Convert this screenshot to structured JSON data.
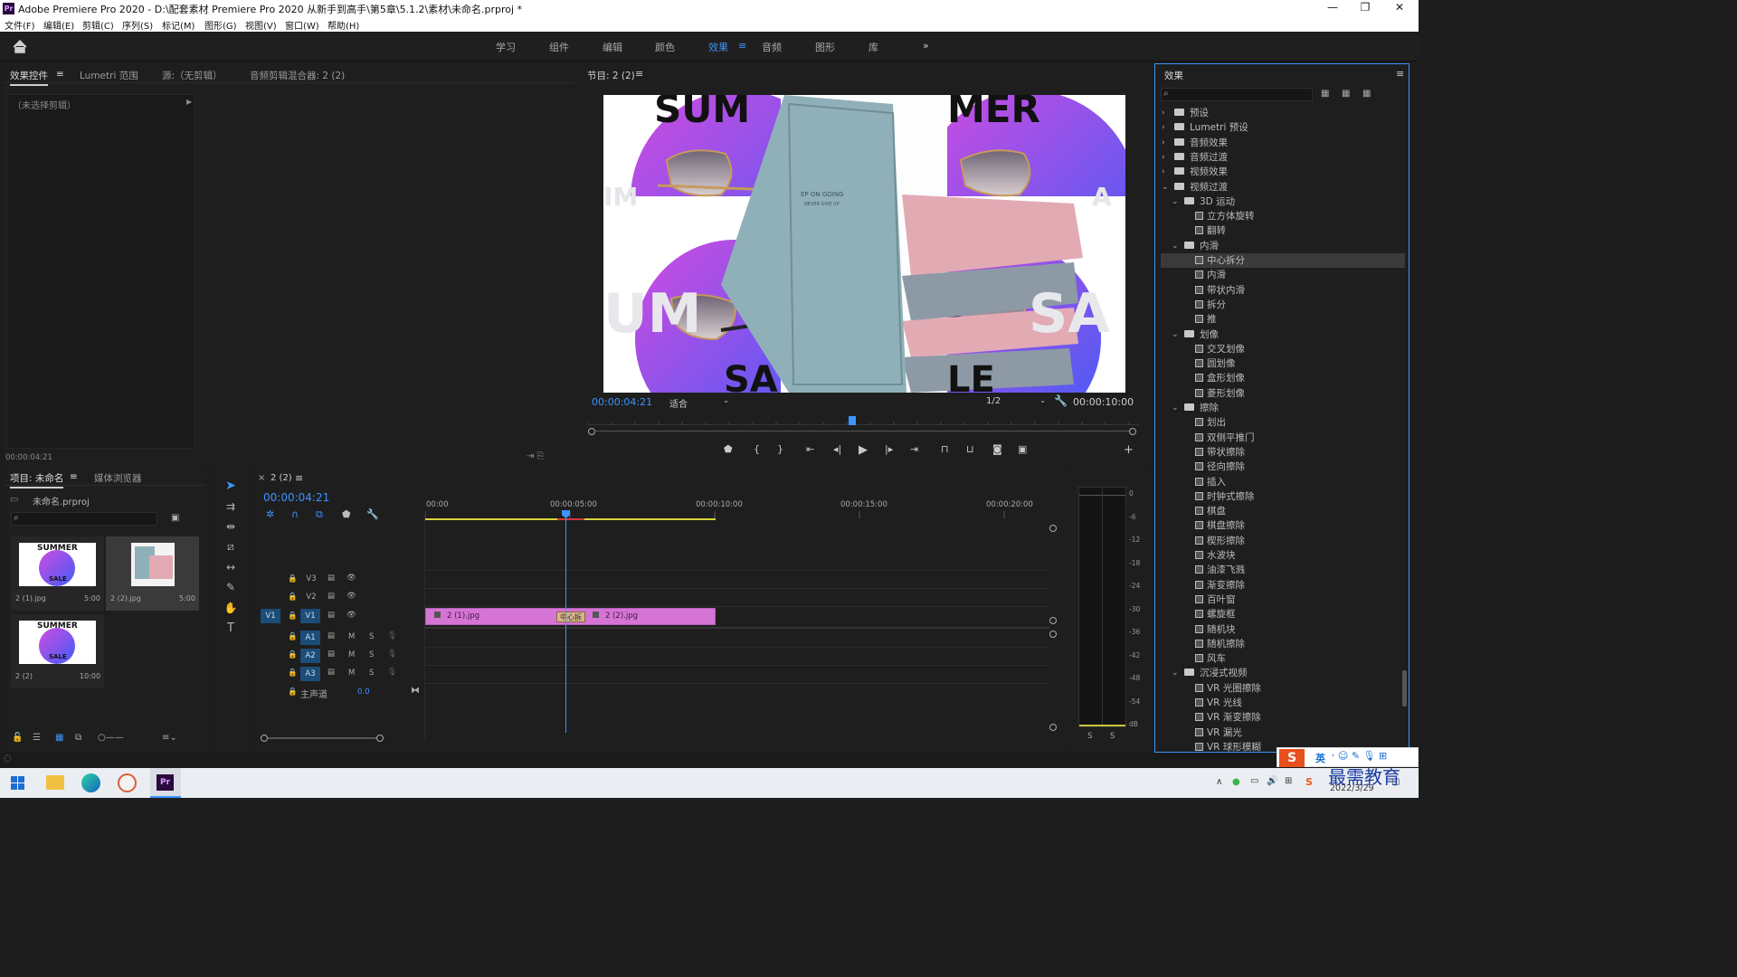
{
  "titlebar": {
    "icon_label": "Pr",
    "title": "Adobe Premiere Pro 2020 - D:\\配套素材 Premiere Pro 2020 从新手到高手\\第5章\\5.1.2\\素材\\未命名.prproj *",
    "minimize": "—",
    "maximize": "❐",
    "close": "✕"
  },
  "menu": [
    "文件(F)",
    "编辑(E)",
    "剪辑(C)",
    "序列(S)",
    "标记(M)",
    "图形(G)",
    "视图(V)",
    "窗口(W)",
    "帮助(H)"
  ],
  "workspaces": [
    "学习",
    "组件",
    "编辑",
    "颜色",
    "效果",
    "音频",
    "图形",
    "库"
  ],
  "workspace_active": "效果",
  "workspace_more": "»",
  "source_panel": {
    "tabs": [
      "效果控件",
      "Lumetri 范围",
      "源:（无剪辑）",
      "音频剪辑混合器: 2 (2)"
    ],
    "no_clip": "（未选择剪辑）",
    "timecode": "00:00:04:21"
  },
  "program": {
    "title": "节目: 2 (2)",
    "timecode": "00:00:04:21",
    "fit": "适合",
    "quality": "1/2",
    "duration": "00:00:10:00",
    "frame_text": {
      "tl": "SUM",
      "tr": "MER",
      "bl": "SA",
      "br": "LE",
      "wm_left": "UM",
      "wm_right": "SA",
      "wm_top": "IM",
      "wm_top_r": "A",
      "notebook_line1": "EP ON GOING",
      "notebook_line2": "NEVER GIVE UP"
    },
    "controls": [
      "marker",
      "in",
      "out",
      "goto-in",
      "step-back",
      "play",
      "step-forward",
      "goto-out",
      "lift",
      "extract",
      "export-frame",
      "compare",
      "add"
    ]
  },
  "project": {
    "tabs": [
      "项目: 未命名",
      "媒体浏览器"
    ],
    "file": "未命名.prproj",
    "items": [
      {
        "name": "2 (1).jpg",
        "dur": "5:00",
        "thumb": "summer"
      },
      {
        "name": "2 (2).jpg",
        "dur": "5:00",
        "thumb": "book"
      },
      {
        "name": "2 (2)",
        "dur": "10:00",
        "thumb": "summer"
      }
    ]
  },
  "timeline": {
    "seq": "2 (2)",
    "timecode": "00:00:04:21",
    "ruler": [
      "00:00",
      "00:00:05:00",
      "00:00:10:00",
      "00:00:15:00",
      "00:00:20:00"
    ],
    "tracks": [
      "V3",
      "V2",
      "V1",
      "A1",
      "A2",
      "A3"
    ],
    "master": "主声道",
    "master_val": "0.0",
    "m": "M",
    "s": "S",
    "clips": [
      {
        "name": "2 (1).jpg"
      },
      {
        "name": "2 (2).jpg"
      }
    ],
    "transition": "中心拆"
  },
  "meter": {
    "ticks": [
      "0",
      "-6",
      "-12",
      "-18",
      "-24",
      "-30",
      "-36",
      "-42",
      "-48",
      "-54",
      "dB"
    ],
    "solo": [
      "S",
      "S"
    ]
  },
  "effects": {
    "title": "效果",
    "items": [
      {
        "lvl": 0,
        "arrow": "›",
        "type": "folder",
        "label": "预设"
      },
      {
        "lvl": 0,
        "arrow": "›",
        "type": "folder",
        "label": "Lumetri 预设"
      },
      {
        "lvl": 0,
        "arrow": "›",
        "type": "folder",
        "label": "音频效果"
      },
      {
        "lvl": 0,
        "arrow": "›",
        "type": "folder",
        "label": "音频过渡"
      },
      {
        "lvl": 0,
        "arrow": "›",
        "type": "folder",
        "label": "视频效果"
      },
      {
        "lvl": 0,
        "arrow": "⌄",
        "type": "folder",
        "label": "视频过渡"
      },
      {
        "lvl": 1,
        "arrow": "⌄",
        "type": "folder",
        "label": "3D 运动"
      },
      {
        "lvl": 2,
        "arrow": "",
        "type": "fx",
        "label": "立方体旋转"
      },
      {
        "lvl": 2,
        "arrow": "",
        "type": "fx",
        "label": "翻转"
      },
      {
        "lvl": 1,
        "arrow": "⌄",
        "type": "folder",
        "label": "内滑"
      },
      {
        "lvl": 2,
        "arrow": "",
        "type": "fx",
        "label": "中心拆分",
        "selected": true
      },
      {
        "lvl": 2,
        "arrow": "",
        "type": "fx",
        "label": "内滑"
      },
      {
        "lvl": 2,
        "arrow": "",
        "type": "fx",
        "label": "带状内滑"
      },
      {
        "lvl": 2,
        "arrow": "",
        "type": "fx",
        "label": "拆分"
      },
      {
        "lvl": 2,
        "arrow": "",
        "type": "fx",
        "label": "推"
      },
      {
        "lvl": 1,
        "arrow": "⌄",
        "type": "folder",
        "label": "划像"
      },
      {
        "lvl": 2,
        "arrow": "",
        "type": "fx",
        "label": "交叉划像"
      },
      {
        "lvl": 2,
        "arrow": "",
        "type": "fx",
        "label": "圆划像"
      },
      {
        "lvl": 2,
        "arrow": "",
        "type": "fx",
        "label": "盒形划像"
      },
      {
        "lvl": 2,
        "arrow": "",
        "type": "fx",
        "label": "菱形划像"
      },
      {
        "lvl": 1,
        "arrow": "⌄",
        "type": "folder",
        "label": "擦除"
      },
      {
        "lvl": 2,
        "arrow": "",
        "type": "fx",
        "label": "划出"
      },
      {
        "lvl": 2,
        "arrow": "",
        "type": "fx",
        "label": "双侧平推门"
      },
      {
        "lvl": 2,
        "arrow": "",
        "type": "fx",
        "label": "带状擦除"
      },
      {
        "lvl": 2,
        "arrow": "",
        "type": "fx",
        "label": "径向擦除"
      },
      {
        "lvl": 2,
        "arrow": "",
        "type": "fx",
        "label": "插入"
      },
      {
        "lvl": 2,
        "arrow": "",
        "type": "fx",
        "label": "时钟式擦除"
      },
      {
        "lvl": 2,
        "arrow": "",
        "type": "fx",
        "label": "棋盘"
      },
      {
        "lvl": 2,
        "arrow": "",
        "type": "fx",
        "label": "棋盘擦除"
      },
      {
        "lvl": 2,
        "arrow": "",
        "type": "fx",
        "label": "楔形擦除"
      },
      {
        "lvl": 2,
        "arrow": "",
        "type": "fx",
        "label": "水波块"
      },
      {
        "lvl": 2,
        "arrow": "",
        "type": "fx",
        "label": "油漆飞溅"
      },
      {
        "lvl": 2,
        "arrow": "",
        "type": "fx",
        "label": "渐变擦除"
      },
      {
        "lvl": 2,
        "arrow": "",
        "type": "fx",
        "label": "百叶窗"
      },
      {
        "lvl": 2,
        "arrow": "",
        "type": "fx",
        "label": "螺旋框"
      },
      {
        "lvl": 2,
        "arrow": "",
        "type": "fx",
        "label": "随机块"
      },
      {
        "lvl": 2,
        "arrow": "",
        "type": "fx",
        "label": "随机擦除"
      },
      {
        "lvl": 2,
        "arrow": "",
        "type": "fx",
        "label": "风车"
      },
      {
        "lvl": 1,
        "arrow": "⌄",
        "type": "folder",
        "label": "沉浸式视频"
      },
      {
        "lvl": 2,
        "arrow": "",
        "type": "fx",
        "label": "VR 光圈擦除"
      },
      {
        "lvl": 2,
        "arrow": "",
        "type": "fx",
        "label": "VR 光线"
      },
      {
        "lvl": 2,
        "arrow": "",
        "type": "fx",
        "label": "VR 渐变擦除"
      },
      {
        "lvl": 2,
        "arrow": "",
        "type": "fx",
        "label": "VR 漏光"
      },
      {
        "lvl": 2,
        "arrow": "",
        "type": "fx",
        "label": "VR 球形模糊"
      }
    ]
  },
  "taskbar": {
    "date": "2022/3/29",
    "ime": "英",
    "watermark": "最需教育",
    "sogou": "S"
  },
  "colors": {
    "accent": "#3b94ff",
    "clip": "#d674d6",
    "playhead": "#3b94ff",
    "panel": "#1e1e1e"
  }
}
